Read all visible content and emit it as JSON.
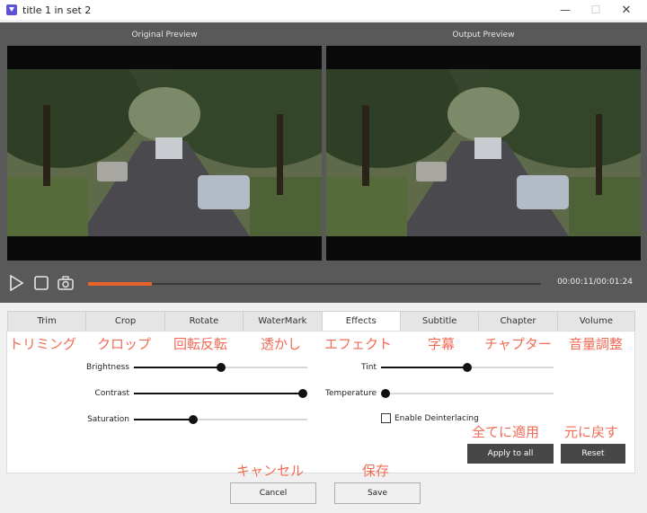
{
  "window": {
    "title": "title 1 in set 2",
    "minimize_glyph": "—",
    "maximize_glyph": "☐",
    "close_glyph": "✕"
  },
  "preview": {
    "original_label": "Original Preview",
    "output_label": "Output Preview",
    "timecode": "00:00:11/00:01:24",
    "progress_fraction": 0.14
  },
  "tabs": [
    {
      "label": "Trim",
      "annotation": "トリミング"
    },
    {
      "label": "Crop",
      "annotation": "クロップ"
    },
    {
      "label": "Rotate",
      "annotation": "回転反転"
    },
    {
      "label": "WaterMark",
      "annotation": "透かし"
    },
    {
      "label": "Effects",
      "annotation": "エフェクト"
    },
    {
      "label": "Subtitle",
      "annotation": "字幕"
    },
    {
      "label": "Chapter",
      "annotation": "チャプター"
    },
    {
      "label": "Volume",
      "annotation": "音量調整"
    }
  ],
  "active_tab": "Effects",
  "effects": {
    "brightness": {
      "label": "Brightness",
      "value": 0.5
    },
    "contrast": {
      "label": "Contrast",
      "value": 1.0
    },
    "saturation": {
      "label": "Saturation",
      "value": 0.34
    },
    "tint": {
      "label": "Tint",
      "value": 0.5
    },
    "temperature": {
      "label": "Temperature",
      "value": 0.0
    },
    "deinterlace": {
      "label": "Enable Deinterlacing",
      "checked": false
    }
  },
  "actions": {
    "apply_all_label": "Apply to all",
    "apply_all_annotation": "全てに適用",
    "reset_label": "Reset",
    "reset_annotation": "元に戻す",
    "cancel_label": "Cancel",
    "cancel_annotation": "キャンセル",
    "save_label": "Save",
    "save_annotation": "保存"
  },
  "colors": {
    "accent": "#e8632b",
    "annotation": "#f26b55",
    "preview_bg": "#595959",
    "button_dark": "#474747"
  },
  "icons": [
    "app-icon",
    "play-icon",
    "stop-icon",
    "camera-icon"
  ]
}
